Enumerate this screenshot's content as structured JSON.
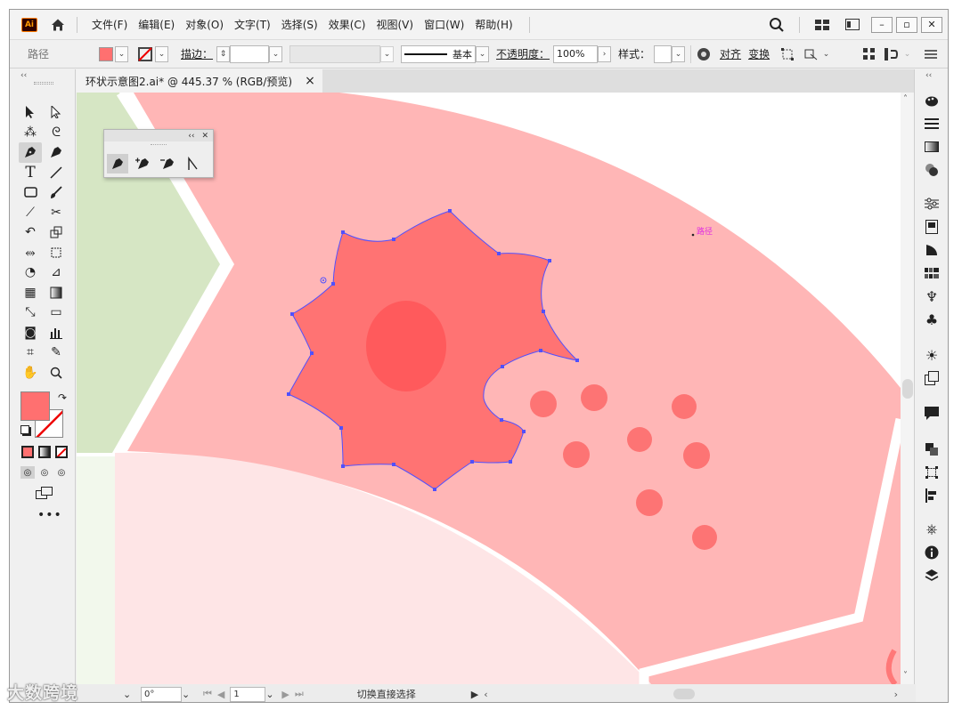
{
  "app": {
    "logo_text": "Ai",
    "menu": [
      "文件(F)",
      "编辑(E)",
      "对象(O)",
      "文字(T)",
      "选择(S)",
      "效果(C)",
      "视图(V)",
      "窗口(W)",
      "帮助(H)"
    ]
  },
  "control_bar": {
    "selection_label": "路径",
    "fill_color": "#ff7070",
    "stroke_label": "描边：",
    "stroke_profile": "基本",
    "opacity_label": "不透明度：",
    "opacity_value": "100%",
    "style_label": "样式：",
    "align_label": "对齐",
    "transform_label": "变换"
  },
  "document": {
    "tab_title": "环状示意图2.ai* @ 445.37 % (RGB/预览)",
    "tab_close": "×"
  },
  "canvas": {
    "path_hint": "路径",
    "colors": {
      "green_band": "#d6e6c4",
      "pale_green": "#f2f8ec",
      "pink_band": "#ffb6b6",
      "light_pink": "#fee5e6",
      "cell_fill": "#ff7373",
      "nucleus": "#ff5a5c",
      "dots": "#fd7474",
      "selection_blue": "#5050ff"
    }
  },
  "status_bar": {
    "rotation": "0°",
    "artboard_number": "1",
    "current_tool": "切换直接选择"
  },
  "watermark": "大数跨境",
  "icons": {
    "home": "home-icon",
    "search": "search-icon",
    "pen": "pen-tool-icon"
  }
}
